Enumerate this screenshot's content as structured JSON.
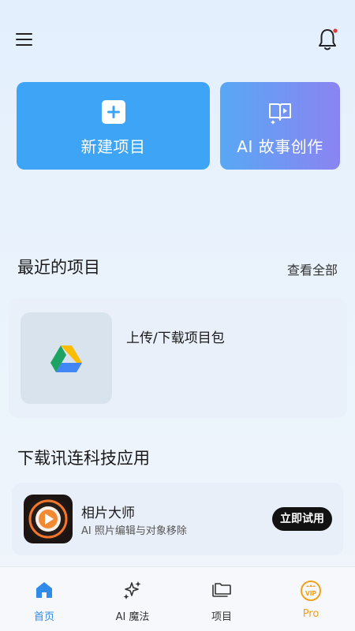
{
  "topbar": {
    "menu_icon": "hamburger-menu-icon",
    "bell_icon": "bell-icon"
  },
  "actions": {
    "new_project": "新建项目",
    "ai_story": "AI 故事创作"
  },
  "recent": {
    "title": "最近的项目",
    "see_all": "查看全部",
    "items": [
      {
        "label": "上传/下载项目包",
        "icon": "google-drive-icon"
      }
    ]
  },
  "download": {
    "title": "下载讯连科技应用",
    "apps": [
      {
        "name": "相片大师",
        "desc": "AI 照片编辑与对象移除",
        "cta": "立即试用"
      }
    ]
  },
  "tabbar": {
    "tabs": [
      {
        "label": "首页",
        "icon": "home-icon",
        "active": true
      },
      {
        "label": "AI 魔法",
        "icon": "sparkle-icon",
        "active": false
      },
      {
        "label": "项目",
        "icon": "folder-icon",
        "active": false
      },
      {
        "label": "Pro",
        "icon": "vip-crown-icon",
        "active": false
      }
    ]
  },
  "colors": {
    "primary": "#3ea4f6",
    "story_gradient_start": "#58a8f4",
    "story_gradient_end": "#8b84f2",
    "tab_active": "#2f8ae8",
    "tab_inactive": "#333333",
    "pro": "#f0a21b",
    "notification_dot": "#e53935"
  }
}
